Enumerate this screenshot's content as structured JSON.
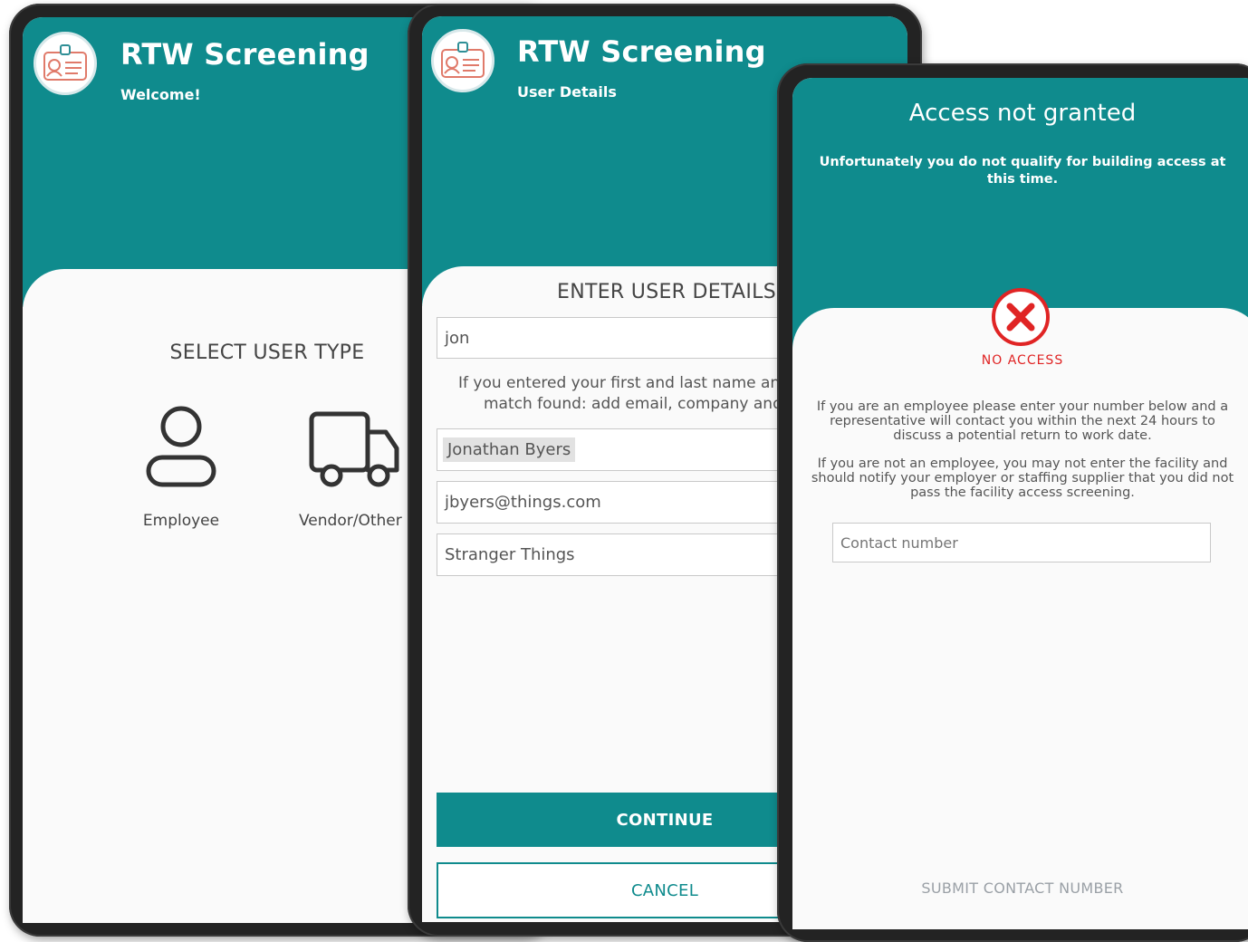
{
  "app": {
    "title": "RTW Screening"
  },
  "colors": {
    "brand": "#0f8b8d",
    "error": "#e02424",
    "bezel": "#232323"
  },
  "screen_welcome": {
    "subtitle": "Welcome!",
    "section_title": "SELECT USER TYPE",
    "options": [
      {
        "label": "Employee",
        "icon": "person-icon"
      },
      {
        "label": "Vendor/Other",
        "icon": "truck-icon"
      }
    ]
  },
  "screen_details": {
    "subtitle": "User Details",
    "section_title": "ENTER USER DETAILS",
    "search_value": "jon",
    "hint_line1": "If you entered your first and last name and",
    "hint_line2": "match found: add email, company and",
    "name_value": "Jonathan Byers",
    "email_value": "jbyers@things.com",
    "company_value": "Stranger Things",
    "continue_label": "CONTINUE",
    "cancel_label": "CANCEL"
  },
  "screen_denied": {
    "heading": "Access not granted",
    "subheading_line1": "Unfortunately you do not qualify for building access at",
    "subheading_line2": "this time.",
    "status_label": "NO ACCESS",
    "para1_line1": "If you are an employee please enter your number below and a",
    "para1_line2": "representative will contact you within the next 24 hours to",
    "para1_line3": "discuss a potential return to work date.",
    "para2_line1": "If you are not an employee, you may not enter the facility and",
    "para2_line2": "should notify your employer or staffing supplier that you did not",
    "para2_line3": "pass the facility access screening.",
    "contact_placeholder": "Contact number",
    "submit_label": "SUBMIT CONTACT NUMBER"
  }
}
